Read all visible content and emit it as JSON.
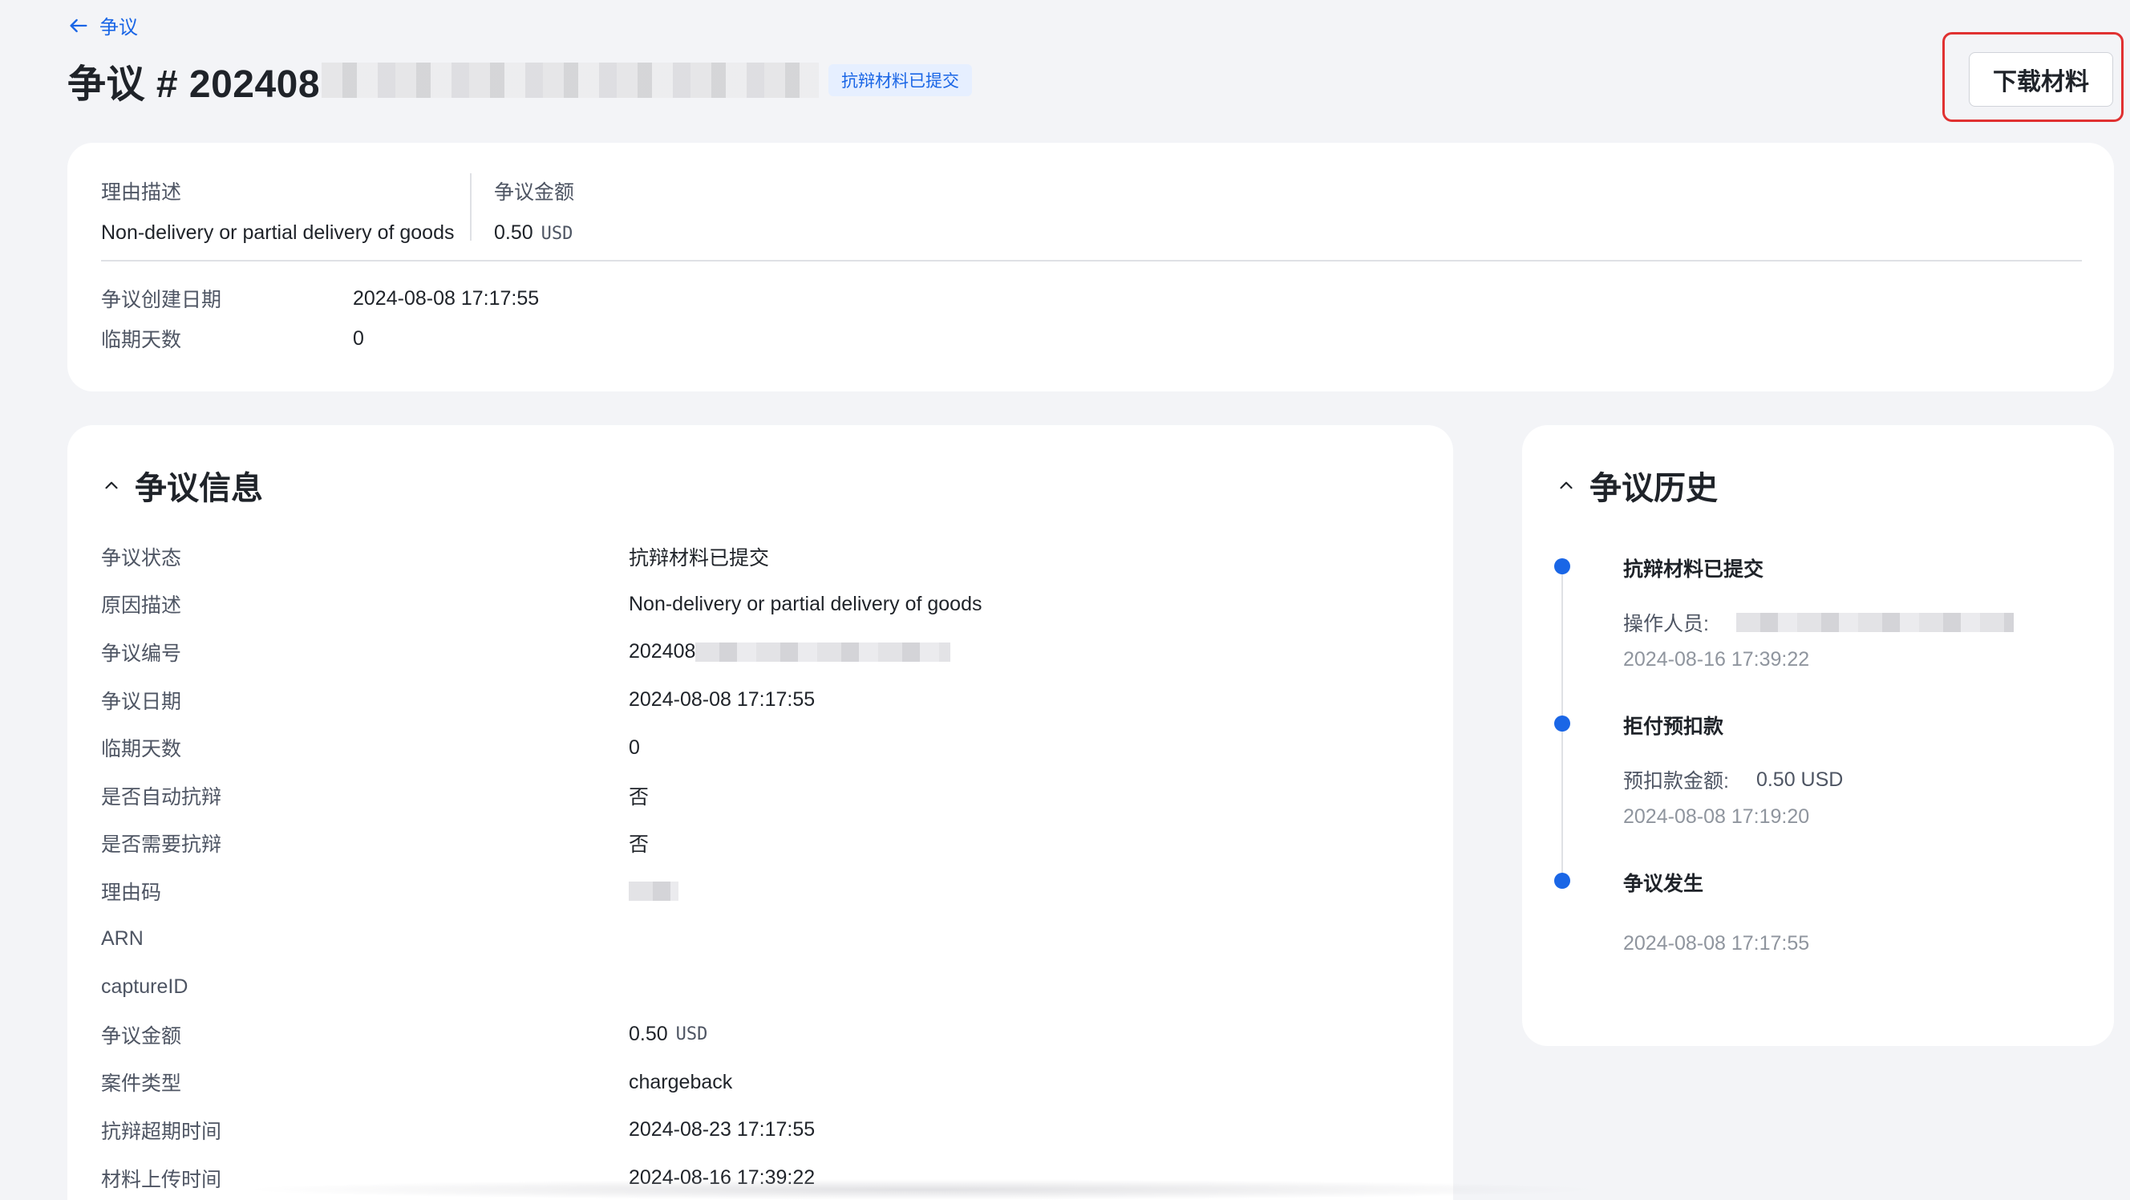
{
  "header": {
    "back_label": "争议",
    "title_prefix": "争议 # 202408",
    "status_tag": "抗辩材料已提交",
    "download_label": "下载材料"
  },
  "summary": {
    "reason_label": "理由描述",
    "reason_value": "Non-delivery or partial delivery of goods",
    "amount_label": "争议金额",
    "amount_value": "0.50",
    "amount_unit": "USD",
    "created_label": "争议创建日期",
    "created_value": "2024-08-08 17:17:55",
    "days_label": "临期天数",
    "days_value": "0"
  },
  "info": {
    "title": "争议信息",
    "rows": [
      {
        "label": "争议状态",
        "value": "抗辩材料已提交"
      },
      {
        "label": "原因描述",
        "value": "Non-delivery or partial delivery of goods"
      },
      {
        "label": "争议编号",
        "value": "202408"
      },
      {
        "label": "争议日期",
        "value": "2024-08-08 17:17:55"
      },
      {
        "label": "临期天数",
        "value": "0"
      },
      {
        "label": "是否自动抗辩",
        "value": "否"
      },
      {
        "label": "是否需要抗辩",
        "value": "否"
      },
      {
        "label": "理由码",
        "value": ""
      },
      {
        "label": "ARN",
        "value": ""
      },
      {
        "label": "captureID",
        "value": ""
      },
      {
        "label": "争议金额",
        "value": "0.50",
        "unit": "USD"
      },
      {
        "label": "案件类型",
        "value": "chargeback"
      },
      {
        "label": "抗辩超期时间",
        "value": "2024-08-23 17:17:55"
      },
      {
        "label": "材料上传时间",
        "value": "2024-08-16 17:39:22"
      }
    ]
  },
  "history": {
    "title": "争议历史",
    "items": [
      {
        "title": "抗辩材料已提交",
        "detail_label": "操作人员:",
        "detail_value": "",
        "time": "2024-08-16 17:39:22"
      },
      {
        "title": "拒付预扣款",
        "detail_label": "预扣款金额:",
        "detail_value": "0.50 USD",
        "time": "2024-08-08 17:19:20"
      },
      {
        "title": "争议发生",
        "detail_label": "",
        "detail_value": "",
        "time": "2024-08-08 17:17:55"
      }
    ]
  },
  "colors": {
    "accent": "#1a66e6",
    "background": "#f3f4f7",
    "highlight": "#e03131"
  }
}
